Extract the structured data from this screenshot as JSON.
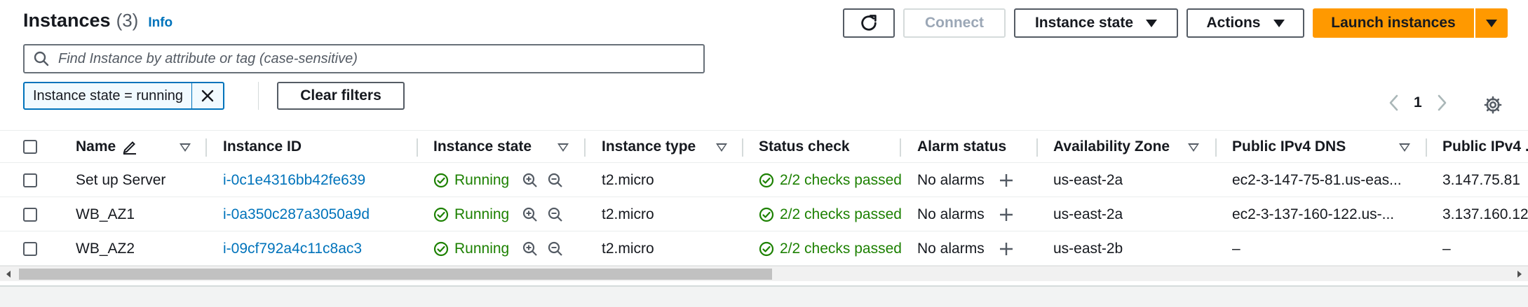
{
  "header": {
    "title": "Instances",
    "count": "(3)",
    "info_label": "Info"
  },
  "toolbar": {
    "refresh_icon": "refresh-icon",
    "connect_label": "Connect",
    "instance_state_label": "Instance state",
    "actions_label": "Actions",
    "launch_label": "Launch instances"
  },
  "search": {
    "placeholder": "Find Instance by attribute or tag (case-sensitive)",
    "value": ""
  },
  "filters": {
    "token_label": "Instance state = running",
    "clear_label": "Clear filters"
  },
  "pagination": {
    "current_page": "1"
  },
  "table": {
    "columns": [
      "Name",
      "Instance ID",
      "Instance state",
      "Instance type",
      "Status check",
      "Alarm status",
      "Availability Zone",
      "Public IPv4 DNS",
      "Public IPv4 ..."
    ],
    "rows": [
      {
        "name": "Set up Server",
        "instance_id": "i-0c1e4316bb42fe639",
        "state": "Running",
        "type": "t2.micro",
        "status_check": "2/2 checks passed",
        "alarm_status": "No alarms",
        "zone": "us-east-2a",
        "dns": "ec2-3-147-75-81.us-eas...",
        "ipv4": "3.147.75.81"
      },
      {
        "name": "WB_AZ1",
        "instance_id": "i-0a350c287a3050a9d",
        "state": "Running",
        "type": "t2.micro",
        "status_check": "2/2 checks passed",
        "alarm_status": "No alarms",
        "zone": "us-east-2a",
        "dns": "ec2-3-137-160-122.us-...",
        "ipv4": "3.137.160.12"
      },
      {
        "name": "WB_AZ2",
        "instance_id": "i-09cf792a4c11c8ac3",
        "state": "Running",
        "type": "t2.micro",
        "status_check": "2/2 checks passed",
        "alarm_status": "No alarms",
        "zone": "us-east-2b",
        "dns": "–",
        "ipv4": "–"
      }
    ]
  },
  "colors": {
    "accent_orange": "#ff9900",
    "link_blue": "#0073bb",
    "success_green": "#1d8102"
  }
}
